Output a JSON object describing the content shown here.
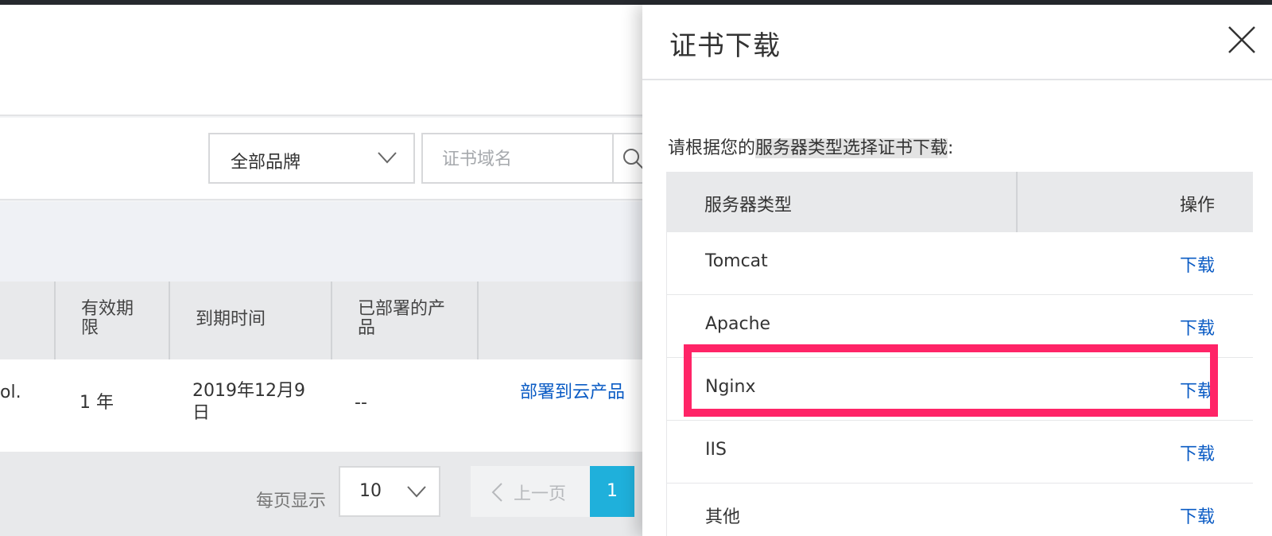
{
  "background_page": {
    "filter": {
      "brand_select_value": "全部品牌",
      "domain_placeholder": "证书域名"
    },
    "table": {
      "headers": [
        "有效期限",
        "到期时间",
        "已部署的产品"
      ],
      "row": {
        "name_fragment": "ol.",
        "validity": "1 年",
        "expiry": "2019年12月9日",
        "deployed": "--",
        "action_link": "部署到云产品"
      }
    },
    "pagination": {
      "per_page_label": "每页显示",
      "per_page_value": "10",
      "prev_label": "上一页",
      "current_page": "1"
    }
  },
  "drawer": {
    "title": "证书下载",
    "instruction_prefix": "请根据您的",
    "instruction_highlight": "服务器类型选择证书下载",
    "instruction_suffix": ":",
    "table": {
      "col_server_type": "服务器类型",
      "col_action": "操作",
      "rows": [
        {
          "server": "Tomcat",
          "action": "下载"
        },
        {
          "server": "Apache",
          "action": "下载"
        },
        {
          "server": "Nginx",
          "action": "下载"
        },
        {
          "server": "IIS",
          "action": "下载"
        },
        {
          "server": "其他",
          "action": "下载"
        }
      ]
    },
    "highlight_color": "#ff2467",
    "link_color": "#0a5bc4"
  }
}
